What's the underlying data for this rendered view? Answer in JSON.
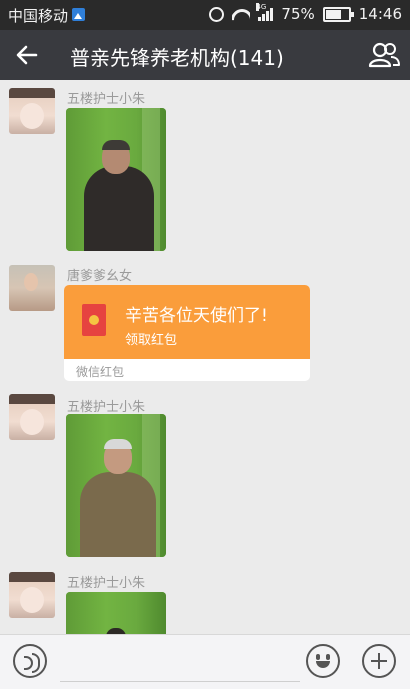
{
  "status_bar": {
    "carrier": "中国移动",
    "network": "4G",
    "battery": "75%",
    "time": "14:46",
    "icons": [
      "gallery-notification-icon",
      "alarm-icon",
      "wifi-icon",
      "signal-icon",
      "battery-icon"
    ]
  },
  "header": {
    "title": "普亲先锋养老机构(141)",
    "back_icon": "back-arrow-icon",
    "members_icon": "group-members-icon"
  },
  "messages": [
    {
      "sender": "五楼护士小朱",
      "type": "image",
      "content": "photo-elderly-man"
    },
    {
      "sender": "唐爹爹幺女",
      "type": "red_packet",
      "greeting": "辛苦各位天使们了!",
      "action": "领取红包",
      "footer": "微信红包"
    },
    {
      "sender": "五楼护士小朱",
      "type": "image",
      "content": "photo-elderly-man-seated"
    },
    {
      "sender": "五楼护士小朱",
      "type": "image",
      "content": "photo-partial"
    }
  ],
  "input_bar": {
    "placeholder": "",
    "icons": [
      "voice-icon",
      "emoji-icon",
      "plus-icon"
    ]
  },
  "colors": {
    "status_bar": "#2a2a2a",
    "title_bar": "#393a3f",
    "chat_bg": "#ebebeb",
    "red_packet": "#fa9d3b"
  }
}
